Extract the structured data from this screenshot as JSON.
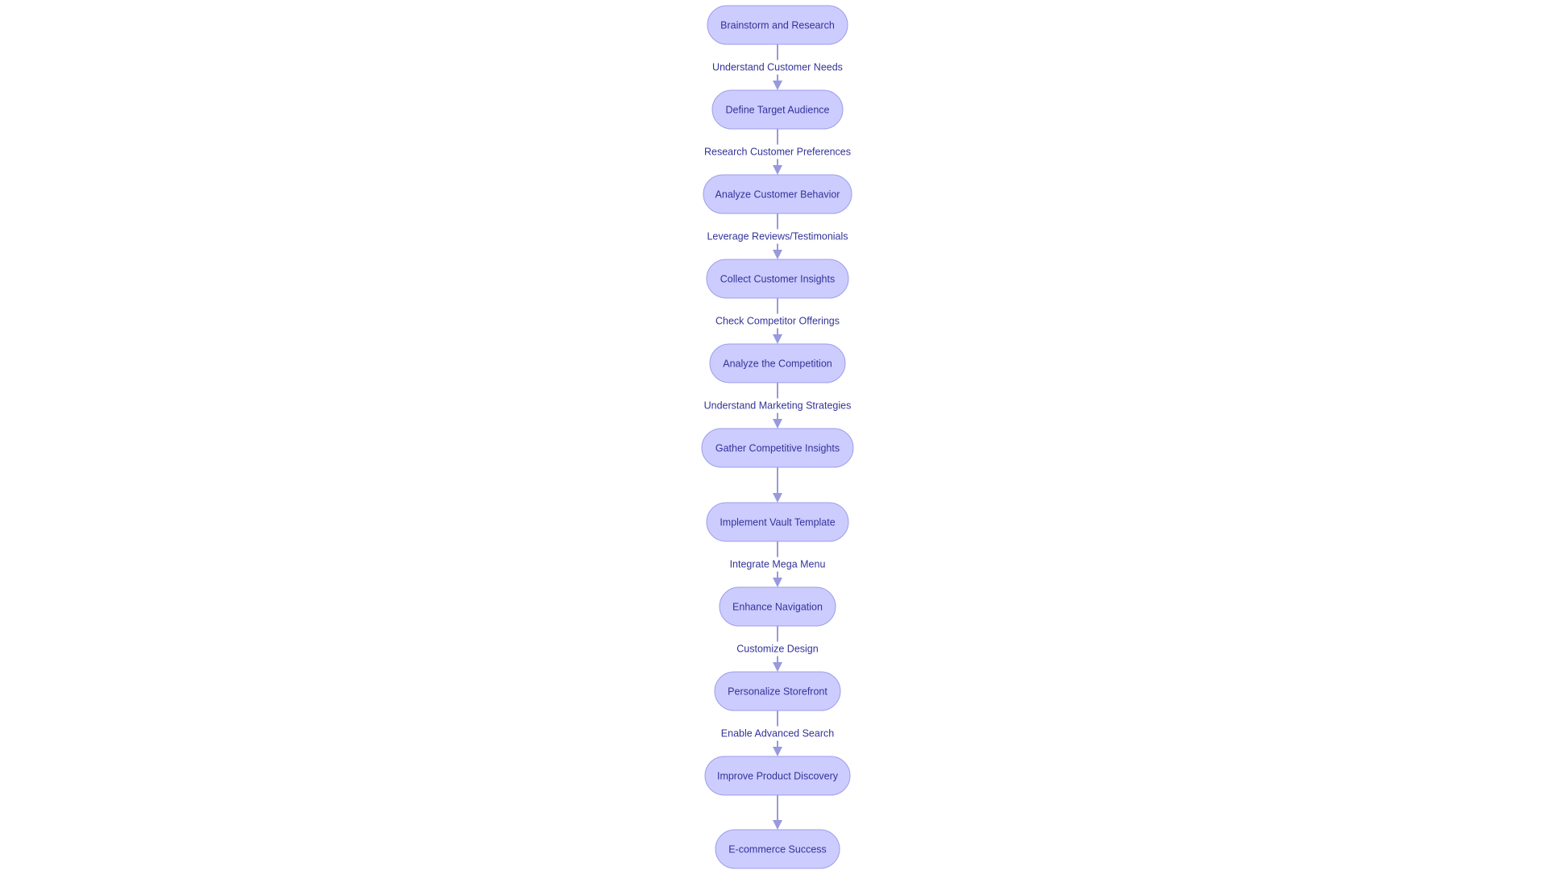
{
  "diagram": {
    "type": "flowchart",
    "direction": "top-down",
    "nodes": [
      {
        "id": "n1",
        "label": "Brainstorm and Research"
      },
      {
        "id": "n2",
        "label": "Define Target Audience"
      },
      {
        "id": "n3",
        "label": "Analyze Customer Behavior"
      },
      {
        "id": "n4",
        "label": "Collect Customer Insights"
      },
      {
        "id": "n5",
        "label": "Analyze the Competition"
      },
      {
        "id": "n6",
        "label": "Gather Competitive Insights"
      },
      {
        "id": "n7",
        "label": "Implement Vault Template"
      },
      {
        "id": "n8",
        "label": "Enhance Navigation"
      },
      {
        "id": "n9",
        "label": "Personalize Storefront"
      },
      {
        "id": "n10",
        "label": "Improve Product Discovery"
      },
      {
        "id": "n11",
        "label": "E-commerce Success"
      }
    ],
    "edges": [
      {
        "from": "n1",
        "to": "n2",
        "label": "Understand Customer Needs"
      },
      {
        "from": "n2",
        "to": "n3",
        "label": "Research Customer Preferences"
      },
      {
        "from": "n3",
        "to": "n4",
        "label": "Leverage Reviews/Testimonials"
      },
      {
        "from": "n4",
        "to": "n5",
        "label": "Check Competitor Offerings"
      },
      {
        "from": "n5",
        "to": "n6",
        "label": "Understand Marketing Strategies"
      },
      {
        "from": "n6",
        "to": "n7",
        "label": ""
      },
      {
        "from": "n7",
        "to": "n8",
        "label": "Integrate Mega Menu"
      },
      {
        "from": "n8",
        "to": "n9",
        "label": "Customize Design"
      },
      {
        "from": "n9",
        "to": "n10",
        "label": "Enable Advanced Search"
      },
      {
        "from": "n10",
        "to": "n11",
        "label": ""
      }
    ],
    "colors": {
      "node_fill": "#ccccff",
      "node_stroke": "#9d9deb",
      "edge": "#9999dd",
      "text": "#333399"
    }
  }
}
